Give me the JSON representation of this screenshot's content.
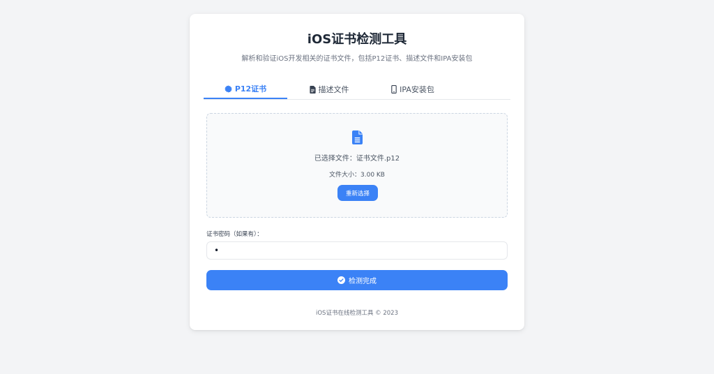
{
  "header": {
    "title": "iOS证书检测工具",
    "subtitle": "解析和验证iOS开发相关的证书文件，包括P12证书、描述文件和IPA安装包"
  },
  "tabs": [
    {
      "label": "P12证书",
      "icon": "certificate-icon",
      "active": true
    },
    {
      "label": "描述文件",
      "icon": "file-contract-icon",
      "active": false
    },
    {
      "label": "IPA安装包",
      "icon": "mobile-icon",
      "active": false
    }
  ],
  "upload": {
    "icon": "file-icon",
    "selected_file": "已选择文件：证书文件.p12",
    "file_size": "文件大小：3.00 KB",
    "reselect_label": "重新选择"
  },
  "password": {
    "label": "证书密码（如果有）：",
    "value": "•"
  },
  "submit": {
    "label": "检测完成",
    "icon": "check-circle-icon"
  },
  "footer": {
    "text": "iOS证书在线检测工具 © 2023"
  },
  "colors": {
    "accent": "#3b82f6",
    "background": "#f3f4f6",
    "card": "#ffffff"
  }
}
